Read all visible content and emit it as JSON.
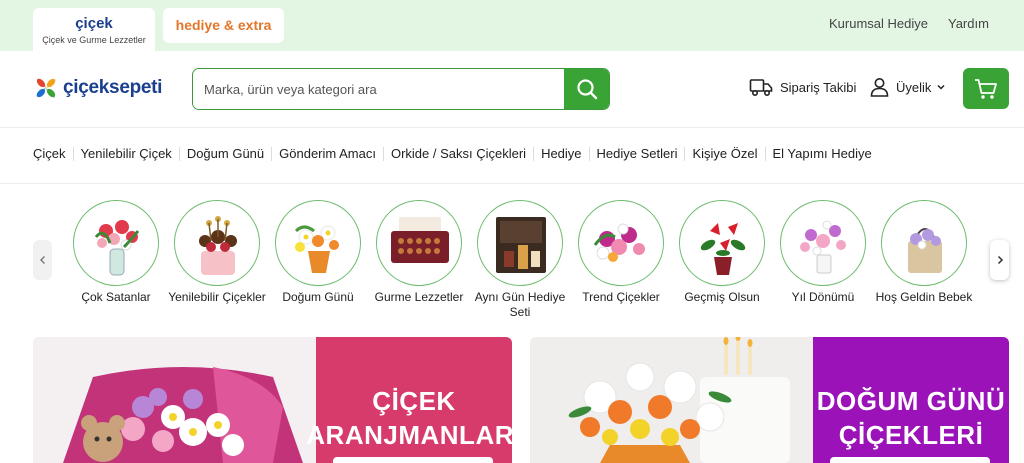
{
  "topbar": {
    "tab_cicek": {
      "title": "çiçek",
      "subtitle": "Çiçek ve Gurme Lezzetler"
    },
    "tab_hediye": "hediye & extra",
    "links": [
      "Kurumsal Hediye",
      "Yardım"
    ]
  },
  "header": {
    "logo_text": "çiçeksepeti",
    "search_placeholder": "Marka, ürün veya kategori ara",
    "order_tracking": "Sipariş Takibi",
    "membership": "Üyelik"
  },
  "nav": {
    "items": [
      "Çiçek",
      "Yenilebilir Çiçek",
      "Doğum Günü",
      "Gönderim Amacı",
      "Orkide / Saksı Çiçekleri",
      "Hediye",
      "Hediye Setleri",
      "Kişiye Özel",
      "El Yapımı Hediye"
    ]
  },
  "categories": [
    {
      "label": "Çok Satanlar"
    },
    {
      "label": "Yenilebilir Çiçekler"
    },
    {
      "label": "Doğum Günü"
    },
    {
      "label": "Gurme Lezzetler"
    },
    {
      "label": "Aynı Gün Hediye Seti"
    },
    {
      "label": "Trend Çiçekler"
    },
    {
      "label": "Geçmiş Olsun"
    },
    {
      "label": "Yıl Dönümü"
    },
    {
      "label": "Hoş Geldin Bebek"
    }
  ],
  "banners": [
    {
      "line1": "ÇİÇEK",
      "line2": "ARANJMANLARI",
      "color": "#d63b6b"
    },
    {
      "line1": "DOĞUM GÜNÜ",
      "line2": "ÇİÇEKLERİ",
      "color": "#9a12b8"
    }
  ],
  "icons": {
    "search": "search-icon",
    "truck": "truck-icon",
    "user": "user-icon",
    "chevron": "chevron-down-icon",
    "cart": "cart-icon",
    "prev": "chevron-left-icon",
    "next": "chevron-right-icon"
  },
  "colors": {
    "brand_green": "#3aa335",
    "brand_blue": "#1b3f8f",
    "topbar_bg": "#e3f5e3",
    "hediye_orange": "#e4762a"
  }
}
